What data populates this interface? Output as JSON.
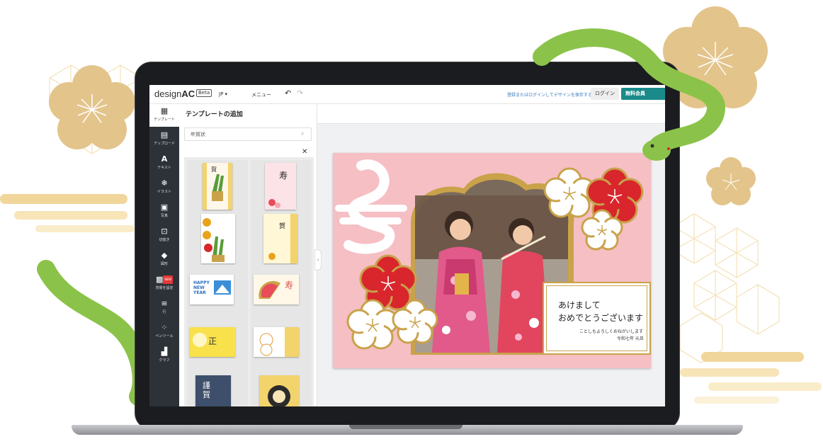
{
  "app": {
    "logo_prefix": "design",
    "logo_suffix": "AC",
    "beta": "Beta",
    "lang": "JP ▾",
    "menu": "メニュー",
    "save_note": "登録またはログインしてデザインを保存する",
    "login": "ログイン",
    "signup": "無料会員"
  },
  "sidebar": {
    "items": [
      {
        "icon": "▦",
        "label": "テンプレート"
      },
      {
        "icon": "▤",
        "label": "アップロード"
      },
      {
        "icon": "A",
        "label": "テキスト"
      },
      {
        "icon": "❄",
        "label": "イラスト"
      },
      {
        "icon": "▣",
        "label": "写真"
      },
      {
        "icon": "⊡",
        "label": "切抜き"
      },
      {
        "icon": "◆",
        "label": "図形"
      },
      {
        "icon": "▩",
        "label": "背景を設定",
        "badge": "NEW"
      },
      {
        "icon": "≡",
        "label": "行"
      },
      {
        "icon": "⁘",
        "label": "ベンツール"
      },
      {
        "icon": "▟",
        "label": "グラフ"
      }
    ]
  },
  "panel": {
    "title": "テンプレートの追加",
    "search_value": "年賀状",
    "close": "✕"
  },
  "templates": {
    "happy_new_year": "HAPPY NEW YEAR",
    "kotobuki": "寿",
    "seal1": "謹",
    "seal2": "賀"
  },
  "card": {
    "line1": "あけまして",
    "line2": "おめでとうございます",
    "line3": "ことしもよろしくおねがいします",
    "line4": "令和七年 元旦"
  },
  "colors": {
    "accent": "#1a8a8a",
    "card_bg": "#f5bfc4",
    "gold": "#c9a24a",
    "plum_red": "#d8262c",
    "snake_green": "#8bc34a",
    "deco_tan": "#e3c48b"
  }
}
